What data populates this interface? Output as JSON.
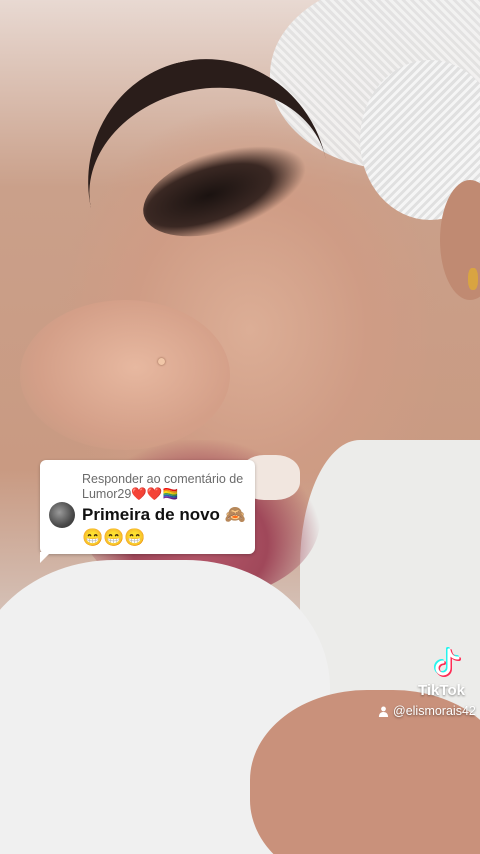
{
  "comment_reply": {
    "reply_to_label": "Responder ao comentário de Lumor29❤️❤️🏳️‍🌈",
    "comment_text": "Primeira de novo 🙈😁😁😁",
    "avatar_icon": "user-avatar"
  },
  "watermark": {
    "logo_icon": "tiktok-logo-icon",
    "brand": "TikTok",
    "username": "@elismorais42",
    "user_icon": "person-icon",
    "colors": {
      "cyan": "#25f4ee",
      "red": "#fe2c55",
      "text": "#ffffff"
    }
  }
}
